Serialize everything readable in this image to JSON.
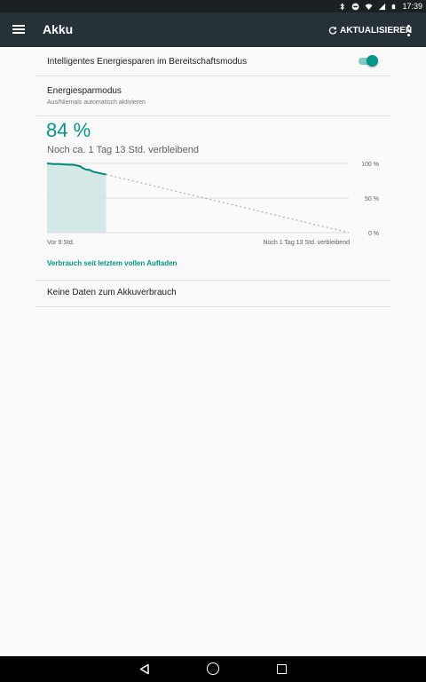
{
  "status_bar": {
    "time": "17:39",
    "icons": [
      "bluetooth-icon",
      "do-not-disturb-icon",
      "wifi-icon",
      "cellular-signal-icon",
      "battery-icon"
    ]
  },
  "app_bar": {
    "title": "Akku",
    "refresh_label": "AKTUALISIEREN",
    "icons": [
      "menu-icon",
      "refresh-icon",
      "overflow-menu-icon"
    ]
  },
  "settings": {
    "smart_saving": {
      "label": "Intelligentes Energiesparen im Bereitschaftsmodus",
      "enabled": true
    },
    "saver_mode": {
      "label": "Energiesparmodus",
      "subtitle": "Aus/Niemals automatisch aktivieren"
    }
  },
  "battery": {
    "percent": "84 %",
    "remaining": "Noch ca. 1 Tag 13 Std. verbleibend",
    "axis_left_label": "Vor 9 Std.",
    "axis_right_label": "Noch 1 Tag 13 Std. verbleibend",
    "since_charge_link": "Verbrauch seit letztem vollen Aufladen",
    "no_data": "Keine Daten zum Akkuverbrauch"
  },
  "chart_data": {
    "type": "line",
    "y_ticks": [
      "100 %",
      "50 %",
      "0 %"
    ],
    "ylim": [
      0,
      100
    ],
    "x_range_hours": [
      -9,
      37
    ],
    "history": {
      "x": [
        -9,
        -8,
        -7,
        -6.5,
        -5.5,
        -5,
        -4,
        -3.5,
        -3,
        -2.5,
        -2,
        -1.5,
        -1,
        0
      ],
      "y": [
        100,
        99,
        99,
        98.5,
        98,
        98,
        96,
        93,
        91,
        90.5,
        88,
        87,
        86,
        84
      ]
    },
    "projection": {
      "x": [
        0,
        37
      ],
      "y": [
        84,
        0
      ]
    },
    "colors": {
      "line": "#00897b",
      "fill": "#cfe6e4",
      "projection": "#b0b0b0",
      "grid": "#dcdcdc"
    }
  },
  "nav_bar": {
    "icons": [
      "back-icon",
      "home-icon",
      "recent-apps-icon"
    ]
  }
}
